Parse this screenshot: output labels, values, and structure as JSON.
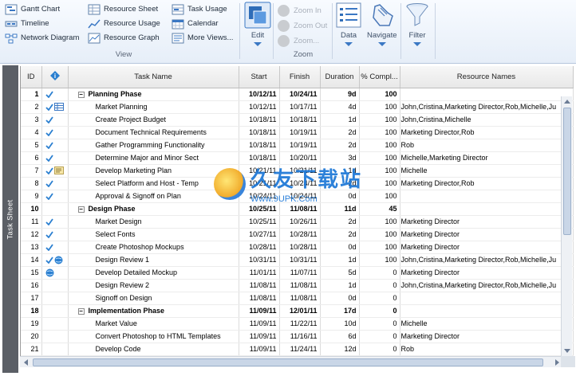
{
  "ribbon": {
    "view_items": [
      {
        "label": "Gantt Chart",
        "icon": "gantt-chart-icon"
      },
      {
        "label": "Timeline",
        "icon": "timeline-icon"
      },
      {
        "label": "Network Diagram",
        "icon": "network-diagram-icon"
      },
      {
        "label": "Resource Sheet",
        "icon": "resource-sheet-icon"
      },
      {
        "label": "Resource Usage",
        "icon": "resource-usage-icon"
      },
      {
        "label": "Resource Graph",
        "icon": "resource-graph-icon"
      },
      {
        "label": "Task Usage",
        "icon": "task-usage-icon"
      },
      {
        "label": "Calendar",
        "icon": "calendar-icon"
      },
      {
        "label": "More Views...",
        "icon": "more-views-icon"
      }
    ],
    "view_group_label": "View",
    "edit_label": "Edit",
    "zoom_in": "Zoom In",
    "zoom_out": "Zoom Out",
    "zoom_more": "Zoom...",
    "zoom_group_label": "Zoom",
    "data_label": "Data",
    "navigate_label": "Navigate",
    "filter_label": "Filter"
  },
  "side_tab": "Task Sheet",
  "table": {
    "headers": {
      "id": "ID",
      "indicators": "i",
      "task_name": "Task Name",
      "start": "Start",
      "finish": "Finish",
      "duration": "Duration",
      "pct": "% Compl...",
      "resources": "Resource Names"
    },
    "rows": [
      {
        "id": "1",
        "name": "Planning Phase",
        "start": "10/12/11",
        "finish": "10/24/11",
        "duration": "9d",
        "pct": "100",
        "resources": "",
        "summary": true,
        "ind": "check"
      },
      {
        "id": "2",
        "name": "Market Planning",
        "start": "10/12/11",
        "finish": "10/17/11",
        "duration": "4d",
        "pct": "100",
        "resources": "John,Cristina,Marketing Director,Rob,Michelle,Ju",
        "ind": "check-sheet"
      },
      {
        "id": "3",
        "name": "Create Project Budget",
        "start": "10/18/11",
        "finish": "10/18/11",
        "duration": "1d",
        "pct": "100",
        "resources": "John,Cristina,Michelle",
        "ind": "check"
      },
      {
        "id": "4",
        "name": "Document Technical Requirements",
        "start": "10/18/11",
        "finish": "10/19/11",
        "duration": "2d",
        "pct": "100",
        "resources": "Marketing Director,Rob",
        "ind": "check"
      },
      {
        "id": "5",
        "name": "Gather Programming Functionality",
        "start": "10/18/11",
        "finish": "10/19/11",
        "duration": "2d",
        "pct": "100",
        "resources": "Rob",
        "ind": "check"
      },
      {
        "id": "6",
        "name": "Determine Major and Minor Sect",
        "start": "10/18/11",
        "finish": "10/20/11",
        "duration": "3d",
        "pct": "100",
        "resources": "Michelle,Marketing Director",
        "ind": "check"
      },
      {
        "id": "7",
        "name": "Develop Marketing Plan",
        "start": "10/21/11",
        "finish": "10/21/11",
        "duration": "1d",
        "pct": "100",
        "resources": "Michelle",
        "ind": "check-note"
      },
      {
        "id": "8",
        "name": "Select Platform and Host - Temp",
        "start": "10/21/11",
        "finish": "10/24/11",
        "duration": "2d",
        "pct": "100",
        "resources": "Marketing Director,Rob",
        "ind": "check"
      },
      {
        "id": "9",
        "name": "Approval & Signoff on Plan",
        "start": "10/24/11",
        "finish": "10/24/11",
        "duration": "0d",
        "pct": "100",
        "resources": "",
        "ind": "check"
      },
      {
        "id": "10",
        "name": "Design Phase",
        "start": "10/25/11",
        "finish": "11/08/11",
        "duration": "11d",
        "pct": "45",
        "resources": "",
        "summary": true,
        "ind": ""
      },
      {
        "id": "11",
        "name": "Market Design",
        "start": "10/25/11",
        "finish": "10/26/11",
        "duration": "2d",
        "pct": "100",
        "resources": "Marketing Director",
        "ind": "check"
      },
      {
        "id": "12",
        "name": "Select Fonts",
        "start": "10/27/11",
        "finish": "10/28/11",
        "duration": "2d",
        "pct": "100",
        "resources": "Marketing Director",
        "ind": "check"
      },
      {
        "id": "13",
        "name": "Create Photoshop Mockups",
        "start": "10/28/11",
        "finish": "10/28/11",
        "duration": "0d",
        "pct": "100",
        "resources": "Marketing Director",
        "ind": "check"
      },
      {
        "id": "14",
        "name": "Design Review 1",
        "start": "10/31/11",
        "finish": "10/31/11",
        "duration": "1d",
        "pct": "100",
        "resources": "John,Cristina,Marketing Director,Rob,Michelle,Ju",
        "ind": "check-globe"
      },
      {
        "id": "15",
        "name": "Develop Detailed Mockup",
        "start": "11/01/11",
        "finish": "11/07/11",
        "duration": "5d",
        "pct": "0",
        "resources": "Marketing Director",
        "ind": "globe"
      },
      {
        "id": "16",
        "name": "Design Review 2",
        "start": "11/08/11",
        "finish": "11/08/11",
        "duration": "1d",
        "pct": "0",
        "resources": "John,Cristina,Marketing Director,Rob,Michelle,Ju",
        "ind": ""
      },
      {
        "id": "17",
        "name": "Signoff on Design",
        "start": "11/08/11",
        "finish": "11/08/11",
        "duration": "0d",
        "pct": "0",
        "resources": "",
        "ind": ""
      },
      {
        "id": "18",
        "name": "Implementation Phase",
        "start": "11/09/11",
        "finish": "12/01/11",
        "duration": "17d",
        "pct": "0",
        "resources": "",
        "summary": true,
        "ind": ""
      },
      {
        "id": "19",
        "name": "Market Value",
        "start": "11/09/11",
        "finish": "11/22/11",
        "duration": "10d",
        "pct": "0",
        "resources": "Michelle",
        "ind": ""
      },
      {
        "id": "20",
        "name": "Convert Photoshop to HTML Templates",
        "start": "11/09/11",
        "finish": "11/16/11",
        "duration": "6d",
        "pct": "0",
        "resources": "Marketing Director",
        "ind": ""
      },
      {
        "id": "21",
        "name": "Develop Code",
        "start": "11/09/11",
        "finish": "11/24/11",
        "duration": "12d",
        "pct": "0",
        "resources": "Rob",
        "ind": ""
      }
    ]
  },
  "watermark": {
    "title": "久友下载站",
    "url": "Www.9UPK.Com"
  },
  "colors": {
    "check": "#2a7fd0",
    "header_bg": "#eeeeee",
    "ribbon_accent": "#3b78c4"
  }
}
